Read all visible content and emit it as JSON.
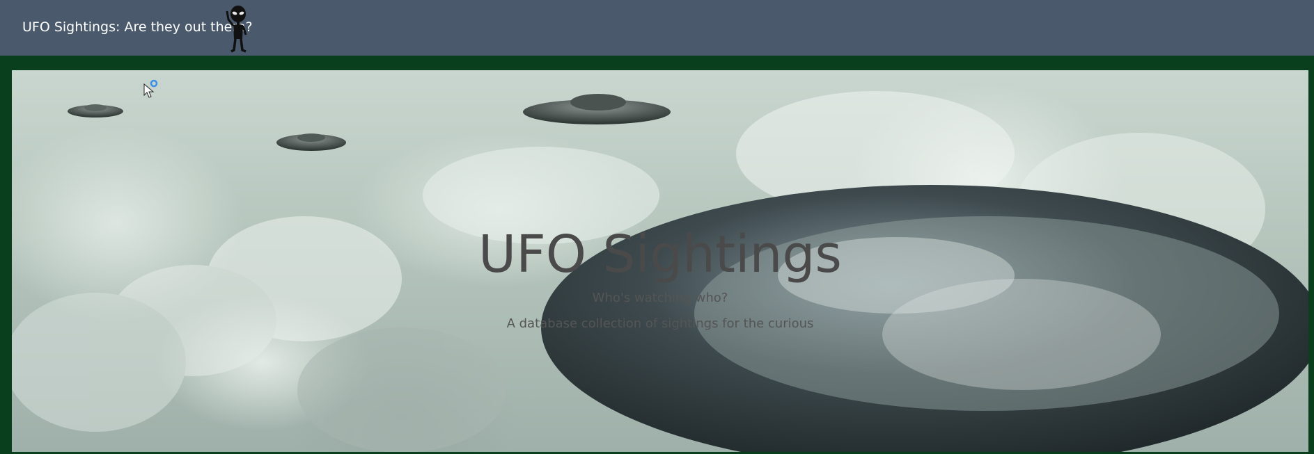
{
  "navbar": {
    "brand_label": "UFO Sightings: Are they out there?",
    "logo_icon": "alien-waving-icon"
  },
  "hero": {
    "title": "UFO Sightings",
    "subtitle": "Who's watching who?",
    "description": "A database collection of sightings for the curious",
    "image_subject": "flying-saucers-in-clouds"
  },
  "colors": {
    "navbar_bg": "#4a5a6c",
    "page_bg": "#0a3f1e",
    "title_text": "#4a4a4a"
  }
}
